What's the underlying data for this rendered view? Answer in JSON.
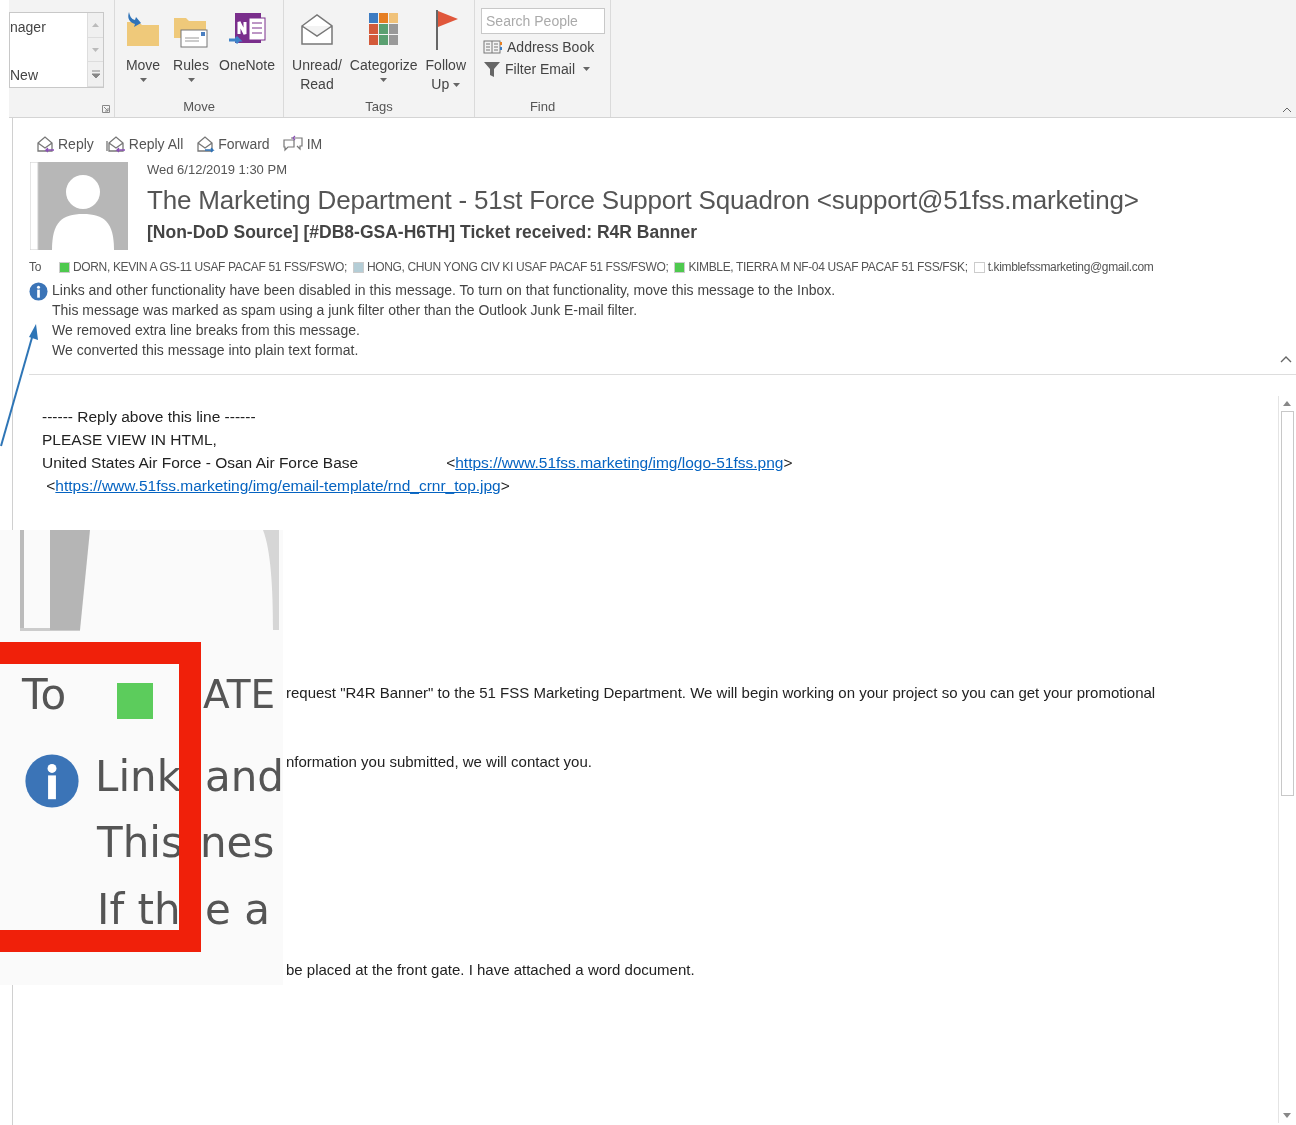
{
  "ribbon": {
    "gallery": {
      "items": [
        "nager",
        "New"
      ]
    },
    "groups": [
      {
        "label": "Move",
        "buttons": [
          {
            "kind": "move",
            "lines": [
              "Move"
            ],
            "dropdown": true
          },
          {
            "kind": "rules",
            "lines": [
              "Rules"
            ],
            "dropdown": true
          },
          {
            "kind": "onenote",
            "lines": [
              "OneNote"
            ],
            "dropdown": false
          }
        ]
      },
      {
        "label": "Tags",
        "buttons": [
          {
            "kind": "envelope",
            "lines": [
              "Unread/",
              "Read"
            ],
            "dropdown": false
          },
          {
            "kind": "categorize",
            "lines": [
              "Categorize"
            ],
            "dropdown": true
          },
          {
            "kind": "flag",
            "lines": [
              "Follow",
              "Up"
            ],
            "dropdown": true
          }
        ]
      }
    ],
    "find": {
      "label": "Find",
      "search": {
        "placeholder": "Search People"
      },
      "items": [
        {
          "kind": "book",
          "label": "Address Book",
          "dropdown": false
        },
        {
          "kind": "filter",
          "label": "Filter Email",
          "dropdown": true
        }
      ]
    }
  },
  "message": {
    "actions": [
      {
        "kind": "reply",
        "label": "Reply"
      },
      {
        "kind": "replyall",
        "label": "Reply All"
      },
      {
        "kind": "forward",
        "label": "Forward"
      },
      {
        "kind": "im",
        "label": "IM"
      }
    ],
    "date": "Wed 6/12/2019 1:30 PM",
    "sender": "The Marketing Department - 51st Force Support Squadron <support@51fss.marketing>",
    "subject": "[Non-DoD Source] [#DB8-GSA-H6TH] Ticket received: R4R Banner",
    "to_label": "To",
    "recipients": [
      {
        "name": "DORN, KEVIN A GS-11 USAF PACAF 51 FSS/FSWO;",
        "color": "#4ec94e"
      },
      {
        "name": "HONG, CHUN YONG CIV KI USAF PACAF 51 FSS/FSWO;",
        "color": "#b4cdd6"
      },
      {
        "name": "KIMBLE, TIERRA M NF-04 USAF PACAF 51 FSS/FSK;",
        "color": "#4ec94e"
      },
      {
        "name": "t.kimblefssmarketing@gmail.com",
        "color": "#ffffff"
      }
    ],
    "infobar": [
      "Links and other functionality have been disabled in this message. To turn on that functionality, move this message to the Inbox.",
      "This message was marked as spam using a junk filter other than the Outlook Junk E-mail filter.",
      "We removed extra line breaks from this message.",
      "We converted this message into plain text format."
    ]
  },
  "body": {
    "lines": [
      {
        "segments": [
          {
            "kind": "text",
            "text": "------ Reply above this line ------"
          }
        ]
      },
      {
        "segments": [
          {
            "kind": "text",
            "text": "PLEASE VIEW IN HTML,"
          }
        ]
      },
      {
        "segments": [
          {
            "kind": "text",
            "text": "United States Air Force - Osan Air Force Base"
          },
          {
            "kind": "text",
            "text": "<",
            "tab_before": true
          },
          {
            "kind": "link",
            "text": "https://www.51fss.marketing/img/logo-51fss.png"
          },
          {
            "kind": "text",
            "text": ">"
          }
        ]
      },
      {
        "segments": [
          {
            "kind": "text",
            "text": " <"
          },
          {
            "kind": "link",
            "text": "https://www.51fss.marketing/img/email-template/rnd_crnr_top.jpg"
          },
          {
            "kind": "text",
            "text": ">"
          }
        ]
      }
    ],
    "later_lines": [
      {
        "kind": "partial",
        "text": "request \"R4R Banner\" to the 51 FSS Marketing Department. We will begin working on your project so you can get your promotional"
      },
      {
        "kind": "partial",
        "text": "nformation you submitted, we will contact you."
      },
      {
        "kind": "partial",
        "text": "be placed at the front gate. I have attached a word document."
      }
    ]
  },
  "zoom_inset": {
    "to_label": "To",
    "recipient": {
      "text": "ATE",
      "color": "#5ccc5c"
    },
    "fragments": [
      "Link",
      "and",
      "This",
      "nes",
      "If th",
      "e a"
    ]
  }
}
